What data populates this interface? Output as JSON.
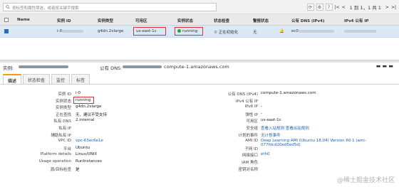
{
  "toolbar": {
    "search_placeholder": "按标签和属性筛选，或者按关键字搜索",
    "pager_text": "1 到 1，1 共 1"
  },
  "table": {
    "headers": [
      "Name",
      "实例 ID",
      "实例类型",
      "可用区",
      "实例状态",
      "状态检查",
      "警报状态",
      "公有 DNS (IPv4)",
      "IPv4 公有 IP"
    ],
    "row": {
      "name": "",
      "instance_id_prefix": "i-0",
      "instance_type": "g4dn.2xlarge",
      "zone": "us-east-1c",
      "state": "running",
      "status_check": "正在初始化",
      "alarm": "无",
      "dns_prefix": "ec0"
    }
  },
  "detail_header": {
    "instance_label": "实例:",
    "dns_label": "公有 DNS:",
    "dns_value": "compute-1.amazonaws.com"
  },
  "tabs": [
    "描述",
    "状态检查",
    "监控",
    "标签"
  ],
  "left_fields": [
    {
      "k": "实例 ID",
      "v": "i-0"
    },
    {
      "k": "实例状态",
      "v": "running"
    },
    {
      "k": "实例类型",
      "v": "g4dn.2xlarge"
    },
    {
      "k": "正在查找",
      "v": "无，建议不受支持"
    },
    {
      "k": "私有 DNS",
      "v": "2.internal"
    },
    {
      "k": "私有 IP",
      "v": ""
    },
    {
      "k": "辅助私有 IP",
      "v": ""
    },
    {
      "k": "VPC ID",
      "v": "vpc-63ec6e1e"
    },
    {
      "k": "平台",
      "v": "Ubuntu"
    },
    {
      "k": "Platform details",
      "v": "Linux/UNIX"
    },
    {
      "k": "Usage operation",
      "v": "RunInstances"
    },
    {
      "k": "源/目标检查",
      "v": "是"
    }
  ],
  "right_fields": [
    {
      "k": "公有 DNS (IPv4)",
      "v": "compute-1.amazonaws.com"
    },
    {
      "k": "IPv4 公有 IP",
      "v": ""
    },
    {
      "k": "IPv6 IP",
      "v": "-"
    },
    {
      "k": "弹性 IP",
      "v": "-"
    },
    {
      "k": "可用区",
      "v": "us-east-1c"
    },
    {
      "k": "安全组",
      "v": "查看入站规则 查看出站规则"
    },
    {
      "k": "计划的事件",
      "v": "无计划事件"
    },
    {
      "k": "AMI ID",
      "v": "Deep Learning AMI (Ubuntu 18.04) Version 60.1 (ami-077fdcd20ed5ed5d)"
    },
    {
      "k": "子网 ID",
      "v": ""
    },
    {
      "k": "网络接口",
      "v": "eth0"
    },
    {
      "k": "IAM 角色",
      "v": ""
    },
    {
      "k": "密钥对名称",
      "v": ""
    }
  ],
  "watermark": "@稀土掘金技术社区",
  "colors": {
    "accent": "#f90",
    "link": "#1a5fb4",
    "highlight": "#e03030",
    "running": "#2ea12e"
  }
}
